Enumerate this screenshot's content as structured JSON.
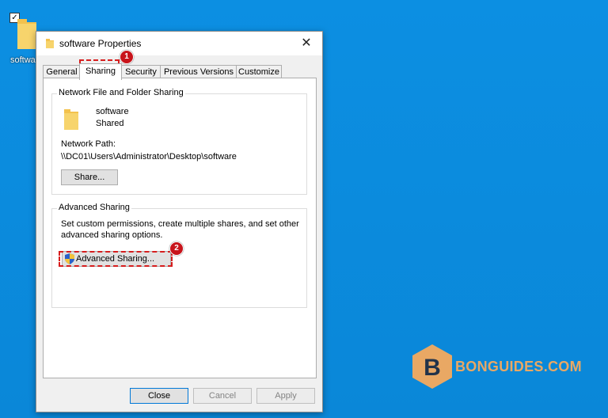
{
  "desktop": {
    "icon_label": "softwa"
  },
  "dialog": {
    "title": "software Properties",
    "close_glyph": "✕",
    "tabs": [
      {
        "label": "General"
      },
      {
        "label": "Sharing"
      },
      {
        "label": "Security"
      },
      {
        "label": "Previous Versions"
      },
      {
        "label": "Customize"
      }
    ],
    "network_sharing": {
      "group_title": "Network File and Folder Sharing",
      "folder_name": "software",
      "status": "Shared",
      "path_label": "Network Path:",
      "path_value": "\\\\DC01\\Users\\Administrator\\Desktop\\software",
      "share_button": "Share..."
    },
    "advanced_sharing": {
      "group_title": "Advanced Sharing",
      "description_line1": "Set custom permissions, create multiple shares, and set other",
      "description_line2": "advanced sharing options.",
      "button": "Advanced Sharing..."
    },
    "footer": {
      "close": "Close",
      "cancel": "Cancel",
      "apply": "Apply"
    }
  },
  "annotations": {
    "step1": "1",
    "step2": "2",
    "color": "#d71d1d"
  },
  "watermark": {
    "text": "BONGUIDES.COM",
    "letter": "B"
  },
  "colors": {
    "desktop": "#0a8ee0",
    "accent": "#0078d7",
    "brand": "#e9a864"
  }
}
